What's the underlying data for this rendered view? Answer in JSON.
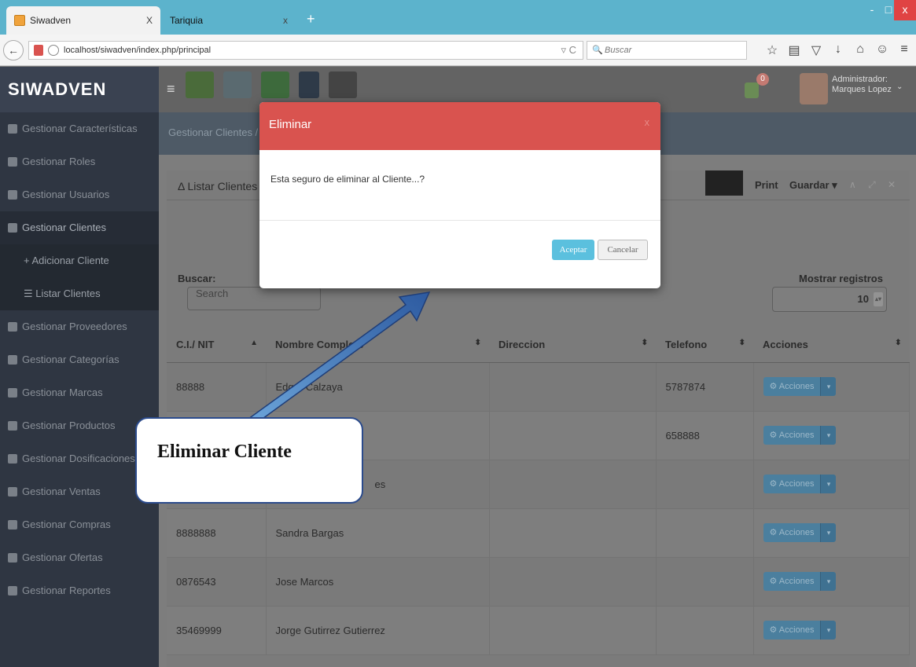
{
  "browser": {
    "tabs": [
      {
        "label": "Siwadven",
        "close": "X"
      },
      {
        "label": "Tariquia",
        "close": "x"
      }
    ],
    "new_tab": "+",
    "window_buttons": {
      "min": "-",
      "max": "□",
      "close": "x"
    },
    "back": "←",
    "url": "localhost/siwadven/index.php/principal",
    "reload": "▿ C",
    "search_placeholder": "Buscar",
    "search_icon": "🔍"
  },
  "app": {
    "brand": "SIWADVEN",
    "menu_icon": "≡",
    "notification_count": "0",
    "user_role": "Administrador:",
    "user_name": "Marques Lopez",
    "user_caret": "⌄"
  },
  "sidebar": {
    "items": [
      {
        "label": "Gestionar Características"
      },
      {
        "label": "Gestionar Roles"
      },
      {
        "label": "Gestionar Usuarios"
      },
      {
        "label": "Gestionar Clientes"
      },
      {
        "label": "+ Adicionar Cliente"
      },
      {
        "label": "☰ Listar Clientes"
      },
      {
        "label": "Gestionar Proveedores"
      },
      {
        "label": "Gestionar Categorías"
      },
      {
        "label": "Gestionar Marcas"
      },
      {
        "label": "Gestionar Productos"
      },
      {
        "label": "Gestionar Dosificaciones"
      },
      {
        "label": "Gestionar Ventas"
      },
      {
        "label": "Gestionar Compras"
      },
      {
        "label": "Gestionar Ofertas"
      },
      {
        "label": "Gestionar Reportes"
      }
    ]
  },
  "main": {
    "breadcrumb": "Gestionar Clientes /",
    "panel_title": "Listar Clientes",
    "print_label": "Print",
    "save_label": "Guardar ▾",
    "panel_icons": "∧ ⤢ ✕",
    "search_label": "Buscar:",
    "search_placeholder": "Search",
    "show_records_label": "Mostrar registros",
    "show_records_value": "10",
    "columns": [
      "C.I./ NIT",
      "Nombre Completo",
      "Direccion",
      "Telefono",
      "Acciones"
    ],
    "sort_asc": "▲",
    "sort_both": "⬍",
    "rows": [
      {
        "ci": "88888",
        "nombre": "Edgar Calzaya",
        "direccion": "",
        "telefono": "5787874"
      },
      {
        "ci": "",
        "nombre": "",
        "direccion": "",
        "telefono": "658888"
      },
      {
        "ci": "",
        "nombre": "es",
        "direccion": "",
        "telefono": ""
      },
      {
        "ci": "8888888",
        "nombre": "Sandra Bargas",
        "direccion": "",
        "telefono": ""
      },
      {
        "ci": "0876543",
        "nombre": "Jose Marcos",
        "direccion": "",
        "telefono": ""
      },
      {
        "ci": "35469999",
        "nombre": "Jorge Gutirrez Gutierrez",
        "direccion": "",
        "telefono": ""
      }
    ],
    "actions_label": "⚙ Acciones",
    "actions_caret": "▾"
  },
  "modal": {
    "title": "Eliminar",
    "close": "x",
    "message": "Esta seguro de eliminar al Cliente...?",
    "accept": "Aceptar",
    "cancel": "Cancelar"
  },
  "annotation": {
    "text": "Eliminar Cliente"
  },
  "colors": {
    "modal_header": "#d9534f",
    "accept_button": "#5bc0de",
    "sidebar_bg": "#2f3642",
    "tabbar": "#5cb3cc",
    "action_button": "#4b7f9e"
  }
}
